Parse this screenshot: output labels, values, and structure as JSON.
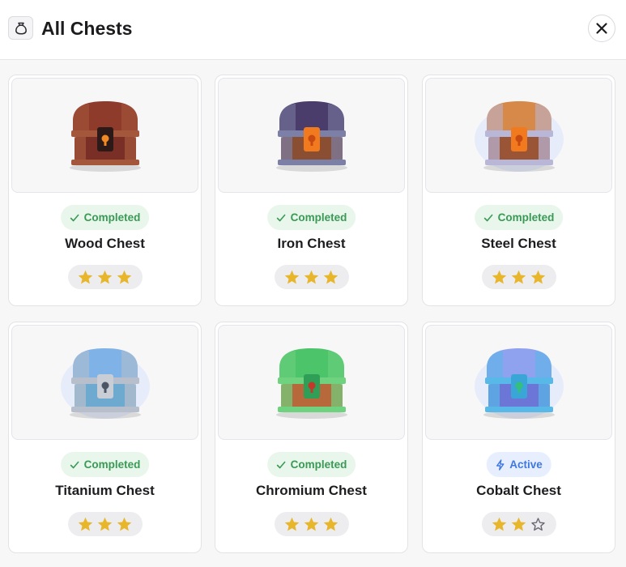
{
  "header": {
    "title": "All Chests",
    "icon": "pouch-icon",
    "close_icon": "close-icon"
  },
  "chests": [
    {
      "name": "Wood Chest",
      "status": "Completed",
      "status_type": "completed",
      "stars": 3,
      "colors": {
        "lid": "#8e3b2c",
        "body": "#7a2f26",
        "band": "#a5573c",
        "lock": "#2b1a17",
        "lock_mark": "#f08a24",
        "glow": ""
      }
    },
    {
      "name": "Iron Chest",
      "status": "Completed",
      "status_type": "completed",
      "stars": 3,
      "colors": {
        "lid": "#4a3d6b",
        "body": "#8a4e32",
        "band": "#7c7fa6",
        "lock": "#f07a1d",
        "lock_mark": "#c84a12",
        "glow": ""
      }
    },
    {
      "name": "Steel Chest",
      "status": "Completed",
      "status_type": "completed",
      "stars": 3,
      "colors": {
        "lid": "#d7894a",
        "body": "#9a5436",
        "band": "#b9b7d8",
        "lock": "#f07a1d",
        "lock_mark": "#c84a12",
        "glow": "#c9d6ff"
      }
    },
    {
      "name": "Titanium Chest",
      "status": "Completed",
      "status_type": "completed",
      "stars": 3,
      "colors": {
        "lid": "#7fb2e6",
        "body": "#6ea9cf",
        "band": "#b7bfcc",
        "lock": "#c8cdd6",
        "lock_mark": "#4b5563",
        "glow": "#c9d6ff"
      }
    },
    {
      "name": "Chromium Chest",
      "status": "Completed",
      "status_type": "completed",
      "stars": 3,
      "colors": {
        "lid": "#4cc46a",
        "body": "#b8693c",
        "band": "#6fd27f",
        "lock": "#2f9e56",
        "lock_mark": "#c0392b",
        "glow": ""
      }
    },
    {
      "name": "Cobalt Chest",
      "status": "Active",
      "status_type": "active",
      "stars": 2,
      "colors": {
        "lid": "#8fa2ef",
        "body": "#6c76d6",
        "band": "#58b8e8",
        "lock": "#3aa6d8",
        "lock_mark": "#34c07a",
        "glow": "#c9d6ff"
      }
    }
  ],
  "max_stars": 3,
  "star_color": "#e8b62a",
  "star_empty_color": "#6b6b70"
}
